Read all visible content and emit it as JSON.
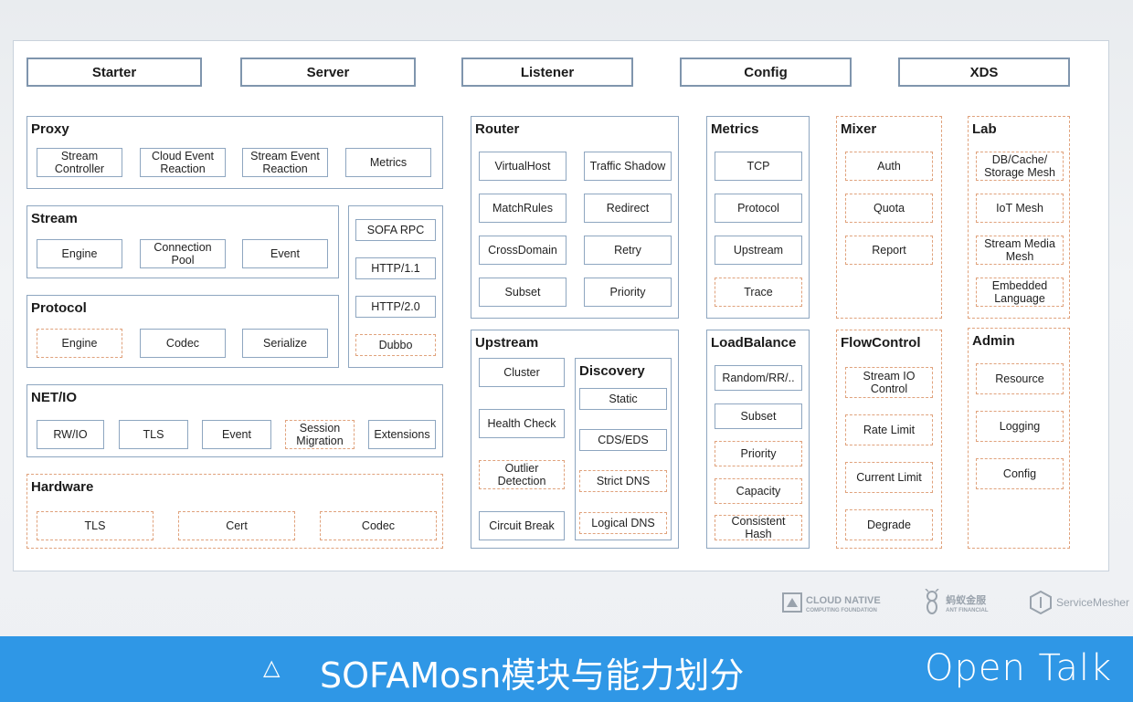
{
  "top": [
    "Starter",
    "Server",
    "Listener",
    "Config",
    "XDS"
  ],
  "proxy": {
    "title": "Proxy",
    "items": [
      "Stream\nController",
      "Cloud Event\nReaction",
      "Stream Event\nReaction",
      "Metrics"
    ]
  },
  "stream": {
    "title": "Stream",
    "items": [
      "Engine",
      "Connection\nPool",
      "Event"
    ]
  },
  "rpc": {
    "items": [
      "SOFA RPC",
      "HTTP/1.1",
      "HTTP/2.0",
      "Dubbo"
    ]
  },
  "protocol": {
    "title": "Protocol",
    "items": [
      "Engine",
      "Codec",
      "Serialize"
    ]
  },
  "netio": {
    "title": "NET/IO",
    "items": [
      "RW/IO",
      "TLS",
      "Event",
      "Session\nMigration",
      "Extensions"
    ]
  },
  "hardware": {
    "title": "Hardware",
    "items": [
      "TLS",
      "Cert",
      "Codec"
    ]
  },
  "router": {
    "title": "Router",
    "items": [
      "VirtualHost",
      "Traffic Shadow",
      "MatchRules",
      "Redirect",
      "CrossDomain",
      "Retry",
      "Subset",
      "Priority"
    ]
  },
  "upstream": {
    "title": "Upstream",
    "items": [
      "Cluster",
      "Health Check",
      "Outlier\nDetection",
      "Circuit Break"
    ]
  },
  "discovery": {
    "title": "Discovery",
    "items": [
      "Static",
      "CDS/EDS",
      "Strict DNS",
      "Logical DNS"
    ]
  },
  "metrics": {
    "title": "Metrics",
    "items": [
      "TCP",
      "Protocol",
      "Upstream",
      "Trace"
    ]
  },
  "loadbalance": {
    "title": "LoadBalance",
    "items": [
      "Random/RR/..",
      "Subset",
      "Priority",
      "Capacity",
      "Consistent\nHash"
    ]
  },
  "mixer": {
    "title": "Mixer",
    "items": [
      "Auth",
      "Quota",
      "Report"
    ]
  },
  "flowcontrol": {
    "title": "FlowControl",
    "items": [
      "Stream IO\nControl",
      "Rate Limit",
      "Current Limit",
      "Degrade"
    ]
  },
  "lab": {
    "title": "Lab",
    "items": [
      "DB/Cache/\nStorage Mesh",
      "IoT Mesh",
      "Stream Media\nMesh",
      "Embedded\nLanguage"
    ]
  },
  "admin": {
    "title": "Admin",
    "items": [
      "Resource",
      "Logging",
      "Config"
    ]
  },
  "logos": {
    "cncf_line1": "CLOUD NATIVE",
    "cncf_line2": "COMPUTING FOUNDATION",
    "ant": "蚂蚁金服",
    "ant_sub": "ANT FINANCIAL",
    "servicemesher": "ServiceMesher"
  },
  "footer": {
    "symbol": "△",
    "title": "SOFAMosn模块与能力划分",
    "brand": "Open Talk"
  },
  "colors": {
    "solid_border": "#8ea6c0",
    "dashed_border": "#e0a27c",
    "footer_bg": "#2f97e6"
  }
}
